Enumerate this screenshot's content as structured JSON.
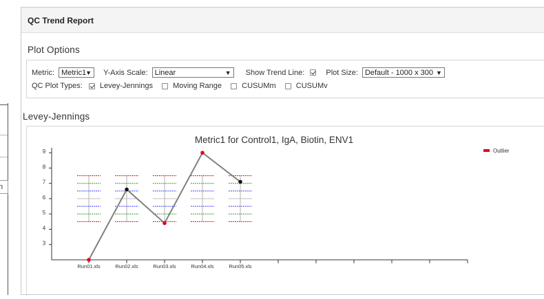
{
  "background": {
    "tab_text": "n"
  },
  "report": {
    "title": "QC Trend Report",
    "plot_options_title": "Plot Options",
    "options": {
      "metric_label": "Metric:",
      "metric_value": "Metric1",
      "yaxis_label": "Y-Axis Scale:",
      "yaxis_value": "Linear",
      "trend_label": "Show Trend Line:",
      "trend_checked": true,
      "plotsize_label": "Plot Size:",
      "plotsize_value": "Default - 1000 x 300",
      "types_label": "QC Plot Types:",
      "types": [
        {
          "label": "Levey-Jennings",
          "checked": true
        },
        {
          "label": "Moving Range",
          "checked": false
        },
        {
          "label": "CUSUMm",
          "checked": false
        },
        {
          "label": "CUSUMv",
          "checked": false
        }
      ]
    },
    "lj_section_title": "Levey-Jennings"
  },
  "chart_data": {
    "type": "line",
    "title": "Metric1 for Control1, IgA, Biotin, ENV1",
    "categories": [
      "Run01.xls",
      "Run02.xls",
      "Run03.xls",
      "Run04.xls",
      "Run05.xls",
      "",
      "",
      "",
      "",
      "",
      ""
    ],
    "y_ticks": [
      3,
      4,
      5,
      6,
      7,
      8,
      9
    ],
    "ylim": [
      2,
      9.1
    ],
    "series": [
      {
        "values": [
          2.0,
          6.6,
          4.4,
          9.0,
          7.1
        ],
        "outlier": [
          true,
          false,
          true,
          true,
          false
        ]
      }
    ],
    "guide_lines": {
      "mean": 6.0,
      "plus_1sd": 6.5,
      "minus_1sd": 5.5,
      "plus_2sd": 7.0,
      "minus_2sd": 5.0,
      "plus_3sd": 7.5,
      "minus_3sd": 4.5
    },
    "legend": [
      {
        "label": "Outlier",
        "color": "#e8001c"
      }
    ],
    "legend_position": "top-right",
    "colors": {
      "line": "#808080",
      "outlier": "#e8001c",
      "point": "#111111",
      "sd1": "#3c3cff",
      "sd2": "#2aa02a",
      "sd3": "#e8001c",
      "mean": "#bdbdbd"
    }
  }
}
